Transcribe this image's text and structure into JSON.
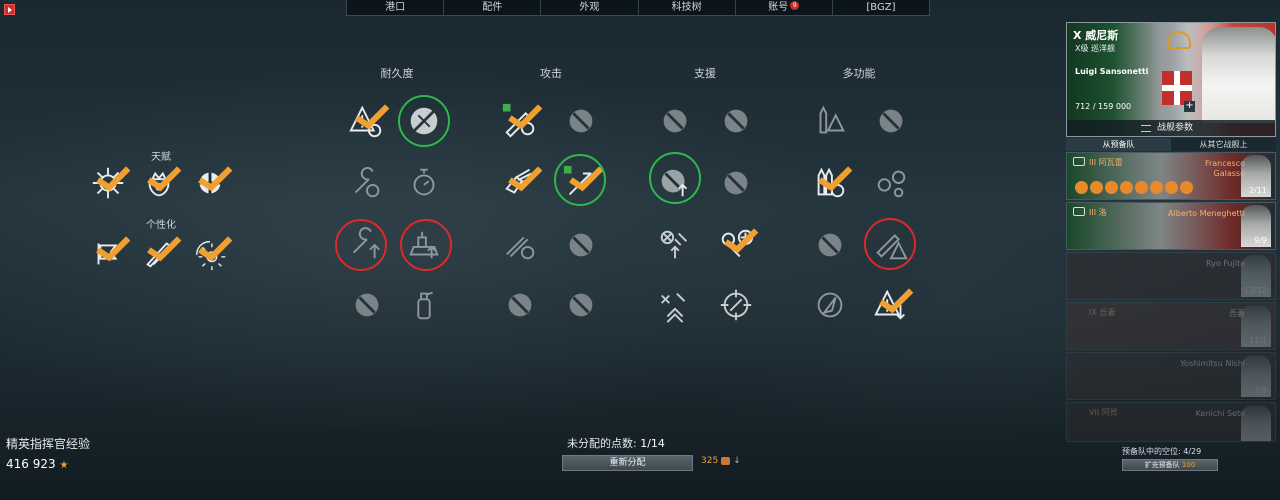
{
  "nav": {
    "tabs": [
      "港口",
      "配件",
      "外观",
      "科技树",
      "账号",
      "[BGZ]"
    ],
    "account_badge": "9"
  },
  "columns": [
    "耐久度",
    "攻击",
    "支援",
    "多功能"
  ],
  "talents": {
    "title": "天赋",
    "personalization": "个性化"
  },
  "skills": [
    {
      "name": "warning-icon",
      "col": 0,
      "row": 0,
      "learned": true
    },
    {
      "name": "anti-torpedo-icon",
      "col": 0,
      "row": 0,
      "learned": false,
      "ring": "green"
    },
    {
      "name": "wrench-clock-icon",
      "col": 0,
      "row": 1,
      "learned": false
    },
    {
      "name": "stopwatch-icon",
      "col": 0,
      "row": 1,
      "learned": false
    },
    {
      "name": "wrench-up-icon",
      "col": 0,
      "row": 2,
      "learned": false,
      "ring": "red"
    },
    {
      "name": "ship-up-icon",
      "col": 0,
      "row": 2,
      "learned": false,
      "ring": "red"
    },
    {
      "name": "disabled-icon",
      "col": 0,
      "row": 3,
      "learned": false
    },
    {
      "name": "extinguisher-icon",
      "col": 0,
      "row": 3,
      "learned": false
    }
  ],
  "footer": {
    "xp_label": "精英指挥官经验",
    "xp_value": "416  923",
    "unassigned_label": "未分配的点数:",
    "unassigned_value": "1/14",
    "reset_button": "重新分配",
    "reset_cost": "325"
  },
  "commander": {
    "ship_name": "X  威尼斯",
    "ship_class": "X级  巡洋舰",
    "name": "Luigi  Sansonetti",
    "exp": "712 / 159  000",
    "params_button": "战舰参数",
    "tab_reserve": "从预备队",
    "tab_other": "从其它战舰上"
  },
  "crew": [
    {
      "ship": "III 阿瓦雷",
      "name": "Francesco\nGalasso",
      "count": "2/11",
      "dim": false
    },
    {
      "ship": "III 洛",
      "name": "Alberto  Meneghetti",
      "count": "9/9",
      "dim": false
    },
    {
      "ship": "",
      "name": "Ryo  Fujita",
      "count": "12/12",
      "dim": true
    },
    {
      "ship": "IX 吾妻",
      "name": "吾妻",
      "count": "11/1",
      "dim": true
    },
    {
      "ship": "",
      "name": "Yoshimitsu  Nishi",
      "count": "2/8",
      "dim": true
    },
    {
      "ship": "VII 阿贺",
      "name": "Kenichi  Seto",
      "count": "",
      "dim": true
    }
  ],
  "reserve": {
    "label": "预备队中的空位:",
    "value": "4/29",
    "expand_button": "扩充预备队",
    "expand_cost": "100"
  },
  "colors": {
    "accent": "#f0a030",
    "ring_red": "#e02828",
    "ring_green": "#2fb84a"
  }
}
